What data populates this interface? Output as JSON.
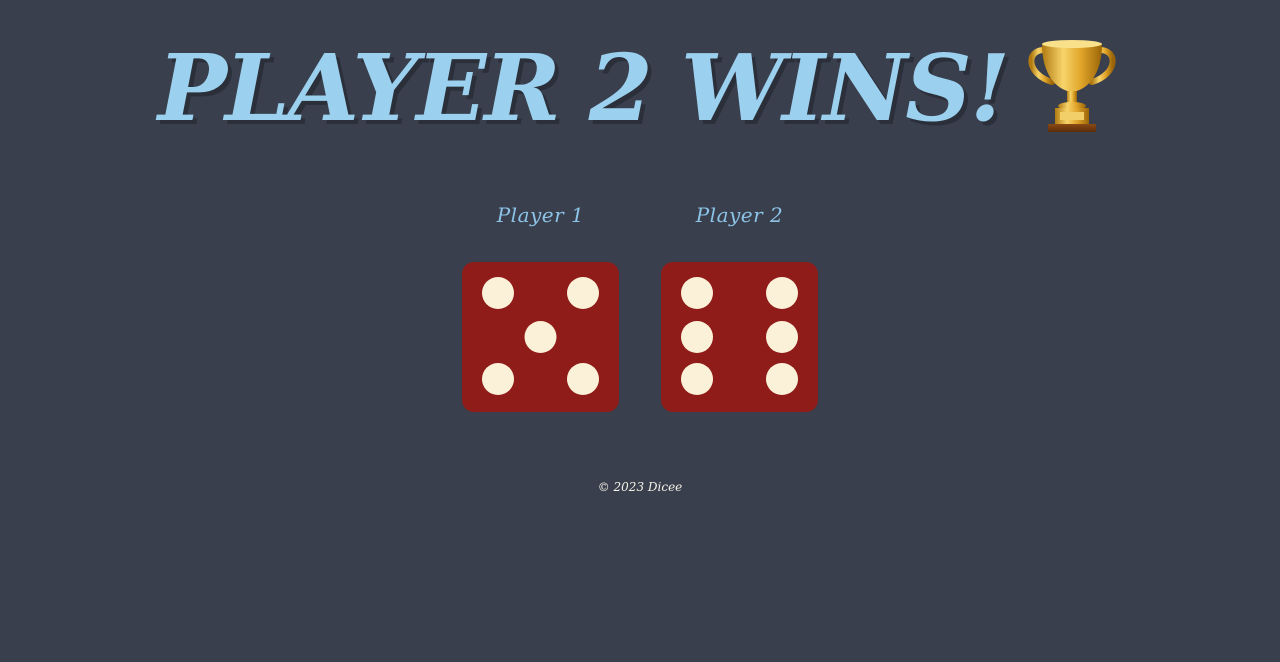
{
  "title": {
    "text": "PLAYER 2 WINS!",
    "icon": "trophy-icon"
  },
  "players": [
    {
      "label": "Player 1",
      "die_value": 5
    },
    {
      "label": "Player 2",
      "die_value": 6
    }
  ],
  "colors": {
    "background": "#393f4d",
    "title": "#9bd0ee",
    "label": "#8cc3e6",
    "die_face": "#8f1c18",
    "pip": "#fbf0d8",
    "footer_text": "#f4f1e6"
  },
  "footer": {
    "text": "© 2023 Dicee"
  }
}
